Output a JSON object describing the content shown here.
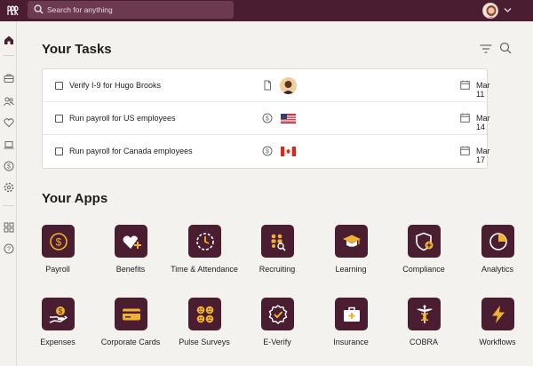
{
  "topbar": {
    "search_placeholder": "Search for anything"
  },
  "sidebar": {
    "items": [
      "home-icon",
      "briefcase-icon",
      "people-icon",
      "heart-icon",
      "laptop-icon",
      "dollar-icon",
      "gear-icon",
      "apps-icon",
      "help-icon"
    ]
  },
  "tasks": {
    "title": "Your Tasks",
    "rows": [
      {
        "label": "Verify I-9 for Hugo Brooks",
        "date": "Mar 11",
        "type_icon": "document-icon",
        "badge": "avatar"
      },
      {
        "label": "Run payroll for US employees",
        "date": "Mar 14",
        "type_icon": "dollar-circle-icon",
        "badge": "us-flag"
      },
      {
        "label": "Run payroll for Canada employees",
        "date": "Mar 17",
        "type_icon": "dollar-circle-icon",
        "badge": "canada-flag"
      }
    ]
  },
  "apps": {
    "title": "Your Apps",
    "items": [
      {
        "label": "Payroll",
        "icon": "dollar-coin-icon"
      },
      {
        "label": "Benefits",
        "icon": "heart-plus-icon"
      },
      {
        "label": "Time & Attendance",
        "icon": "clock-icon"
      },
      {
        "label": "Recruiting",
        "icon": "recruiting-icon"
      },
      {
        "label": "Learning",
        "icon": "graduation-cap-icon"
      },
      {
        "label": "Compliance",
        "icon": "shield-check-icon"
      },
      {
        "label": "Analytics",
        "icon": "pie-chart-icon"
      },
      {
        "label": "Expenses",
        "icon": "hand-dollar-icon"
      },
      {
        "label": "Corporate Cards",
        "icon": "credit-card-icon"
      },
      {
        "label": "Pulse Surveys",
        "icon": "faces-icon"
      },
      {
        "label": "E-Verify",
        "icon": "verify-badge-icon"
      },
      {
        "label": "Insurance",
        "icon": "medical-bag-icon"
      },
      {
        "label": "COBRA",
        "icon": "caduceus-icon"
      },
      {
        "label": "Workflows",
        "icon": "lightning-icon"
      }
    ]
  },
  "colors": {
    "brand": "#4a1d31",
    "accent": "#f1b22f",
    "background": "#f4f2ef"
  }
}
